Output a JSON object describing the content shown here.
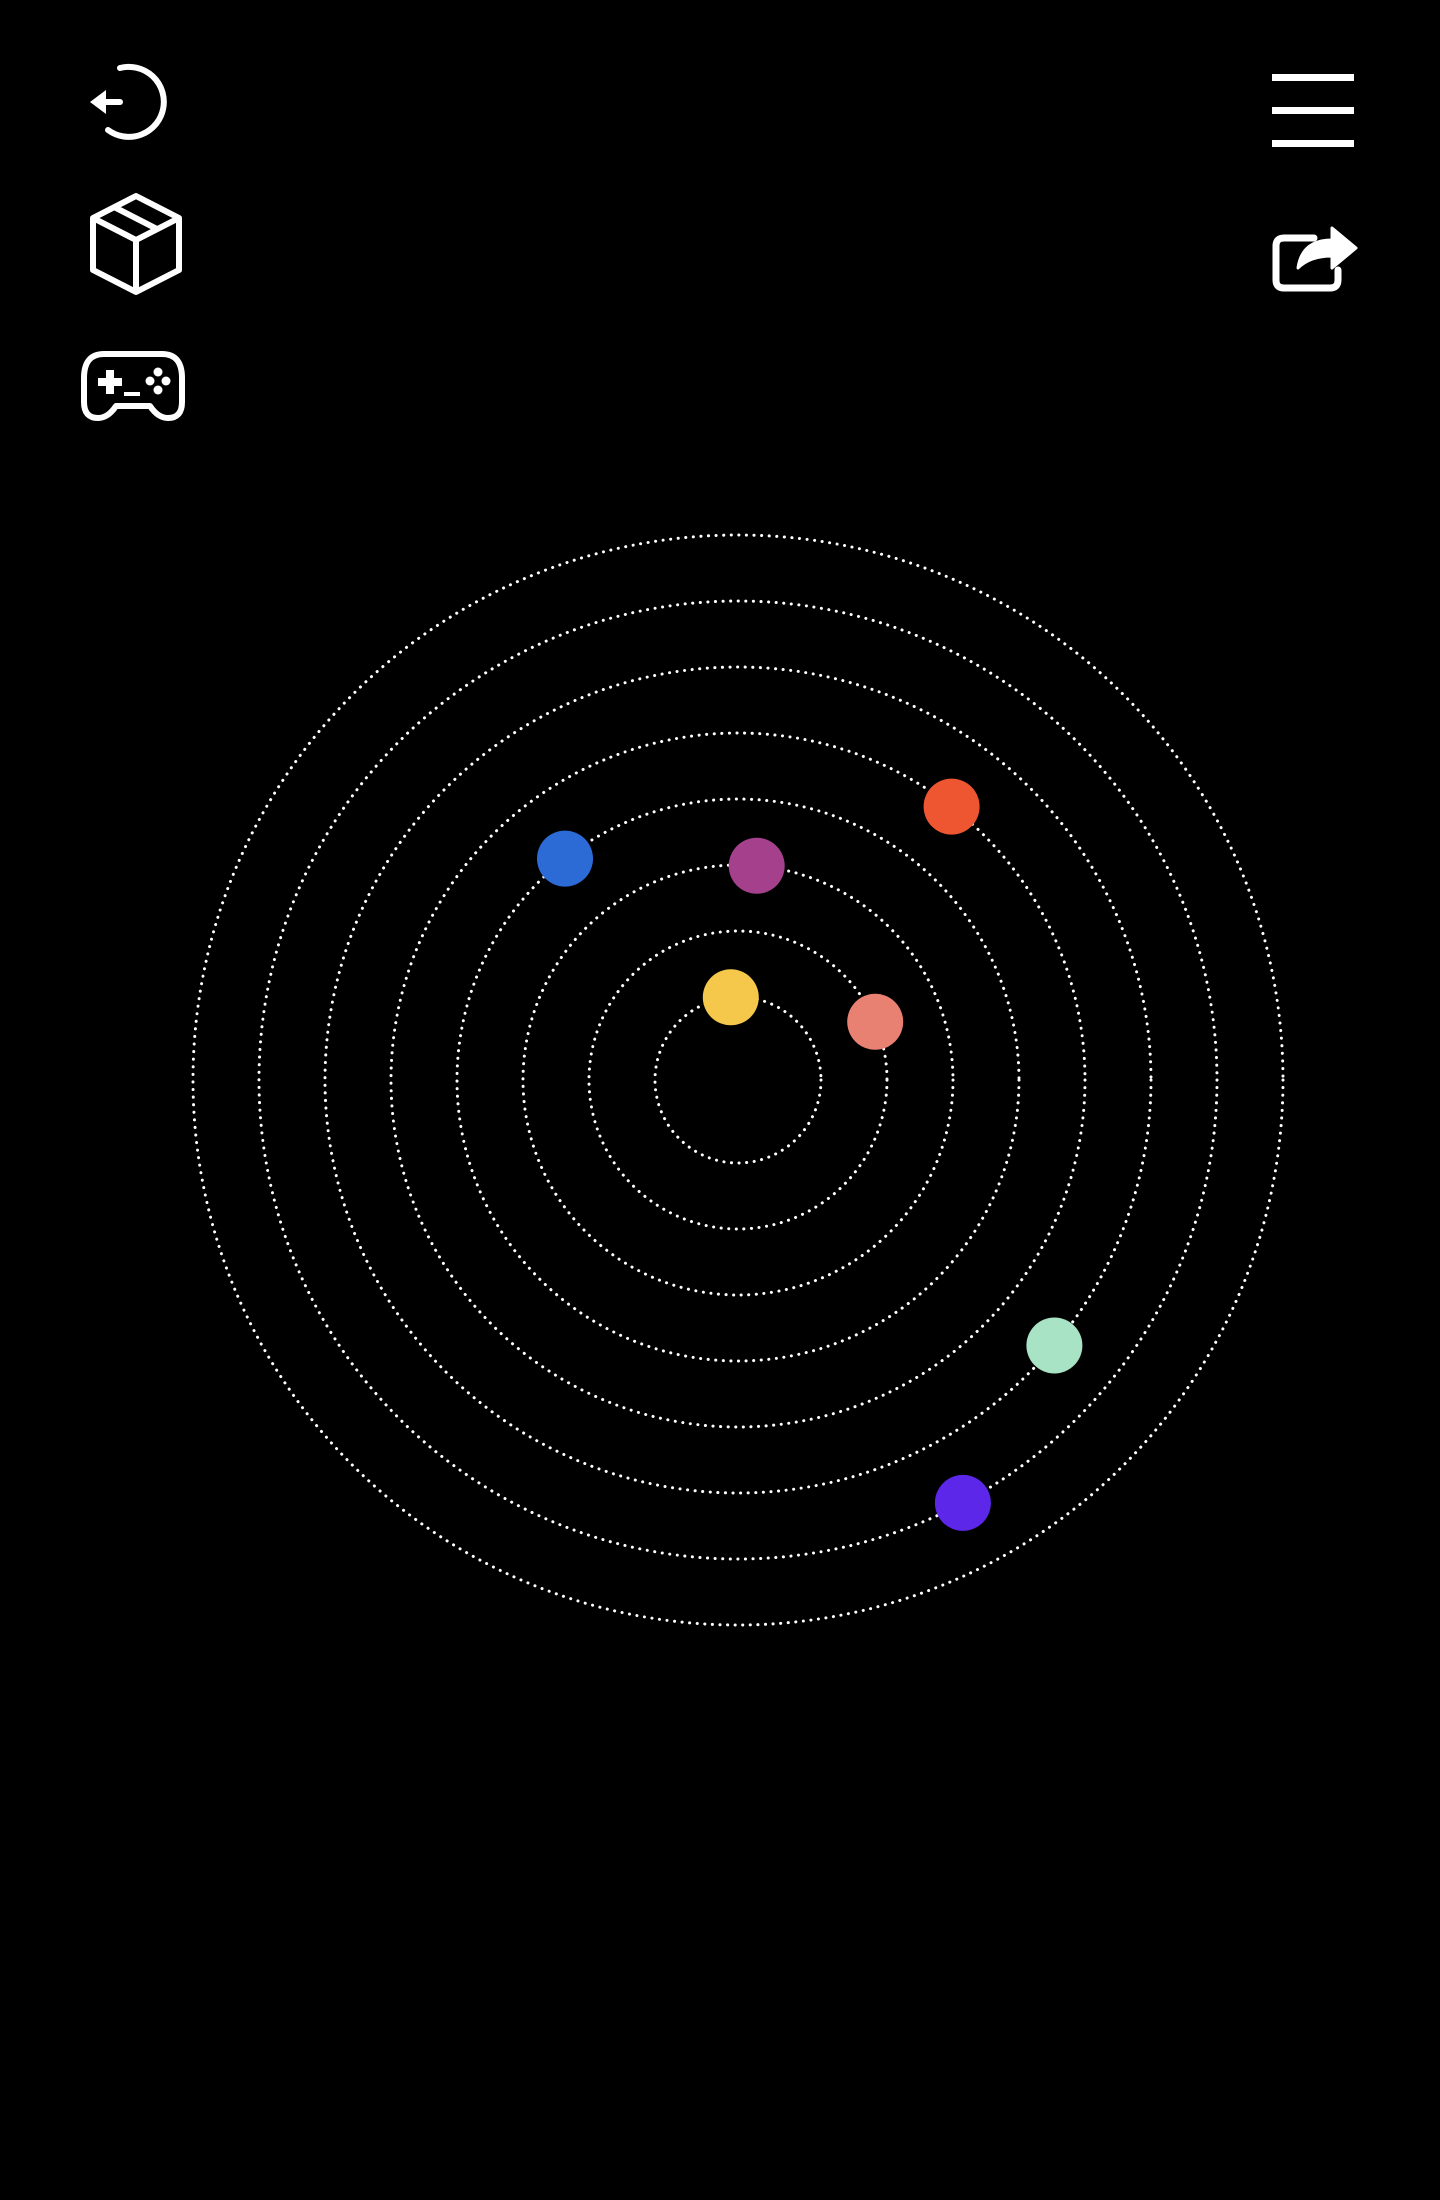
{
  "toolbar_left": {
    "items": [
      {
        "icon": "undo-icon",
        "name": "undo-button"
      },
      {
        "icon": "box-icon",
        "name": "box-button"
      },
      {
        "icon": "gamepad-icon",
        "name": "gamepad-button"
      }
    ]
  },
  "toolbar_right": {
    "items": [
      {
        "icon": "hamburger-menu-icon",
        "name": "menu-button"
      },
      {
        "icon": "share-icon",
        "name": "share-button"
      }
    ]
  },
  "colors": {
    "background": "#000000",
    "icon": "#ffffff",
    "orbit": "#ffffff"
  },
  "orbits": {
    "count": 8,
    "style": "dotted"
  },
  "planets": [
    {
      "orbit": 1,
      "color": "#F5C84B",
      "angle_deg": 95
    },
    {
      "orbit": 2,
      "color": "#E98172",
      "angle_deg": 23
    },
    {
      "orbit": 3,
      "color": "#A4408C",
      "angle_deg": 85
    },
    {
      "orbit": 4,
      "color": "#2C6BD6",
      "angle_deg": 128
    },
    {
      "orbit": 5,
      "color": "#EE5531",
      "angle_deg": 52
    },
    {
      "orbit": 6,
      "color": "#A8E3C5",
      "angle_deg": -40
    },
    {
      "orbit": 7,
      "color": "#5D27EA",
      "angle_deg": -62
    }
  ]
}
